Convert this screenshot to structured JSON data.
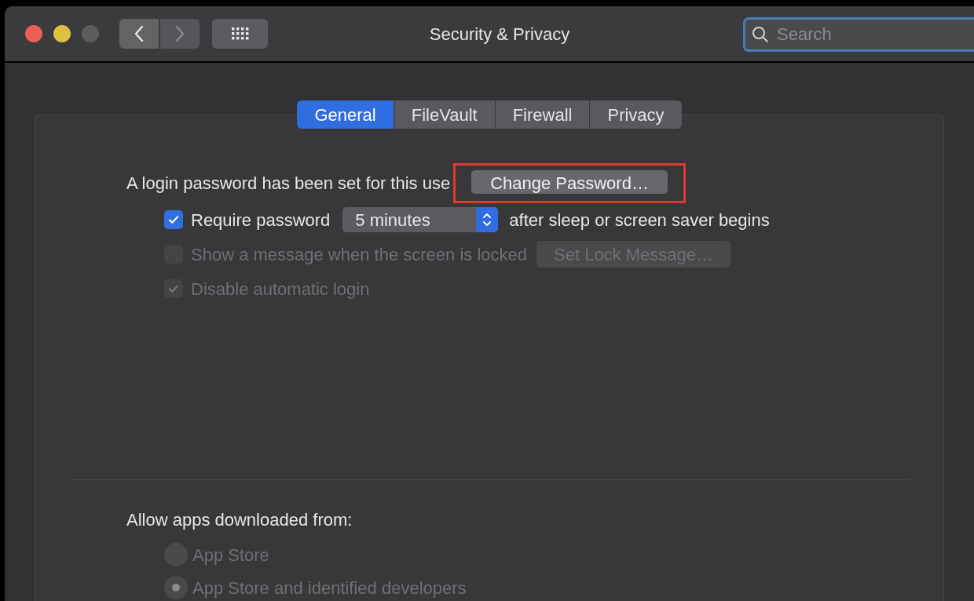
{
  "window": {
    "title": "Security & Privacy"
  },
  "toolbar": {
    "search": {
      "placeholder": "Search"
    }
  },
  "tabs": [
    {
      "label": "General",
      "selected": true
    },
    {
      "label": "FileVault",
      "selected": false
    },
    {
      "label": "Firewall",
      "selected": false
    },
    {
      "label": "Privacy",
      "selected": false
    }
  ],
  "general": {
    "password_label": "A login password has been set for this use",
    "change_password_button": {
      "label": "Change Password…",
      "highlighted": true
    },
    "options": [
      {
        "kind": "select",
        "checked": true,
        "disabled": false,
        "label": "Require password",
        "select_value": "5 minutes",
        "suffix": "after sleep or screen saver begins"
      },
      {
        "kind": "button",
        "checked": false,
        "disabled": true,
        "label": "Show a message when the screen is locked",
        "button": "Set Lock Message…"
      },
      {
        "kind": "plain",
        "checked": true,
        "disabled": true,
        "label": "Disable automatic login"
      }
    ]
  },
  "downloads": {
    "label": "Allow apps downloaded from:",
    "options": [
      {
        "label": "App Store",
        "selected": false,
        "disabled": true
      },
      {
        "label": "App Store and identified developers",
        "selected": true,
        "disabled": true
      }
    ]
  }
}
